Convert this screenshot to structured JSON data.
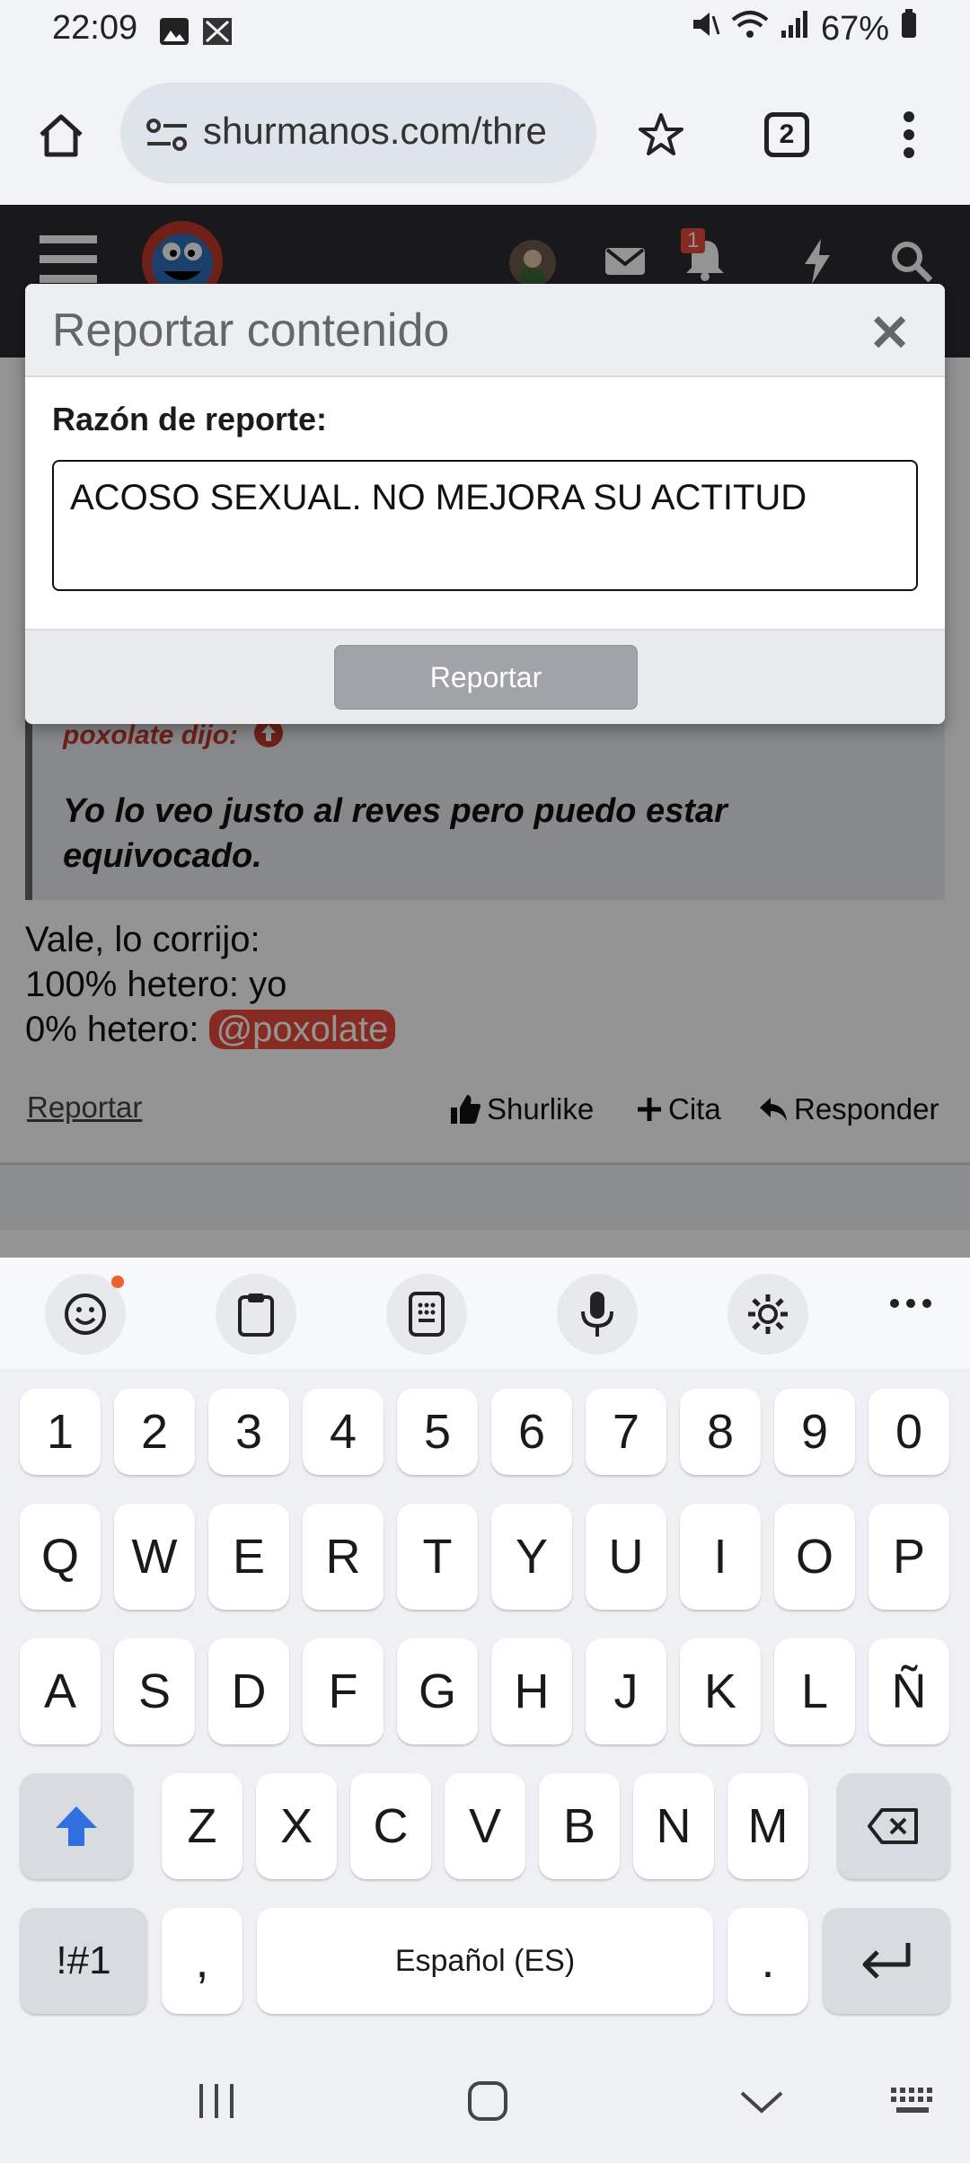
{
  "status": {
    "time": "22:09",
    "battery": "67%"
  },
  "browser": {
    "url": "shurmanos.com/thre",
    "tab_count": "2"
  },
  "header": {
    "notification_count": "1"
  },
  "post": {
    "quote_author": "poxolate dijo:",
    "quote_text": "Yo lo veo justo al reves pero puedo estar equivocado.",
    "line1": "Vale, lo corrijo:",
    "line2": "100% hetero: yo",
    "line3_prefix": "0% hetero: ",
    "mention": "@poxolate",
    "report_link": "Reportar",
    "like_label": "Shurlike",
    "quote_label": "Cita",
    "reply_label": "Responder"
  },
  "modal": {
    "title": "Reportar contenido",
    "close": "✕",
    "reason_label": "Razón de reporte:",
    "reason_value": "ACOSO SEXUAL. NO MEJORA SU ACTITUD",
    "submit_label": "Reportar"
  },
  "keyboard": {
    "row_numbers": [
      "1",
      "2",
      "3",
      "4",
      "5",
      "6",
      "7",
      "8",
      "9",
      "0"
    ],
    "row_q": [
      "Q",
      "W",
      "E",
      "R",
      "T",
      "Y",
      "U",
      "I",
      "O",
      "P"
    ],
    "row_a": [
      "A",
      "S",
      "D",
      "F",
      "G",
      "H",
      "J",
      "K",
      "L",
      "Ñ"
    ],
    "row_z": [
      "Z",
      "X",
      "C",
      "V",
      "B",
      "N",
      "M"
    ],
    "symbols_label": "!#1",
    "comma": ",",
    "space_label": "Español (ES)",
    "period": "."
  },
  "colors": {
    "accent": "#e84a3b",
    "keyboard_shift": "#2f6fe0"
  }
}
